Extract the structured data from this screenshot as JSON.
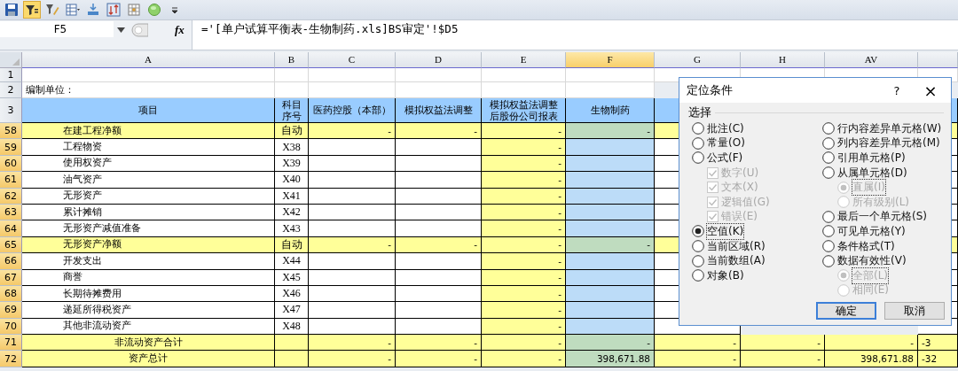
{
  "toolbar": [
    {
      "kind": "save",
      "selected": false
    },
    {
      "kind": "filter",
      "selected": true
    },
    {
      "kind": "clear-filter",
      "selected": false
    },
    {
      "kind": "table",
      "selected": false
    },
    {
      "kind": "insert",
      "selected": false
    },
    {
      "kind": "sort",
      "selected": false
    },
    {
      "kind": "grid",
      "selected": false
    },
    {
      "kind": "circle",
      "selected": false
    },
    {
      "kind": "more",
      "selected": false
    }
  ],
  "formula_bar": {
    "name_box": "F5",
    "fx": "fx",
    "formula": "='[单户试算平衡表-生物制药.xls]BS审定'!$D5"
  },
  "columns": [
    {
      "label": "A",
      "selected": false
    },
    {
      "label": "B",
      "selected": false
    },
    {
      "label": "C",
      "selected": false
    },
    {
      "label": "D",
      "selected": false
    },
    {
      "label": "E",
      "selected": false
    },
    {
      "label": "F",
      "selected": true
    },
    {
      "label": "G",
      "selected": false
    },
    {
      "label": "H",
      "selected": false
    },
    {
      "label": "AV",
      "selected": false
    }
  ],
  "rows": [
    {
      "num": "1",
      "kind": "blank",
      "selected": false
    },
    {
      "num": "2",
      "kind": "info",
      "selected": false,
      "item": "编制单位："
    },
    {
      "num": "3",
      "kind": "heading",
      "selected": false,
      "item": "项目",
      "code": "科目序号",
      "c": "医药控股（本部）",
      "d": "模拟权益法调整",
      "e": "模拟权益法调整后股份公司报表",
      "f": "生物制药"
    },
    {
      "num": "58",
      "kind": "subtotal",
      "selected": true,
      "item": "在建工程净额",
      "code": "自动",
      "c": "-",
      "d": "-",
      "e": "-",
      "f": "-"
    },
    {
      "num": "59",
      "kind": "detail",
      "selected": true,
      "item": "工程物资",
      "code": "X38",
      "e": "-"
    },
    {
      "num": "60",
      "kind": "detail",
      "selected": true,
      "item": "使用权资产",
      "code": "X39",
      "e": "-"
    },
    {
      "num": "61",
      "kind": "detail",
      "selected": true,
      "item": "油气资产",
      "code": "X40",
      "e": "-"
    },
    {
      "num": "62",
      "kind": "detail",
      "selected": true,
      "item": "无形资产",
      "code": "X41",
      "e": "-"
    },
    {
      "num": "63",
      "kind": "detail",
      "selected": true,
      "item": "累计摊销",
      "code": "X42",
      "e": "-"
    },
    {
      "num": "64",
      "kind": "detail",
      "selected": true,
      "item": "无形资产减值准备",
      "code": "X43",
      "e": "-"
    },
    {
      "num": "65",
      "kind": "subtotal",
      "selected": true,
      "item": "无形资产净额",
      "code": "自动",
      "c": "-",
      "d": "-",
      "e": "-",
      "f": "-"
    },
    {
      "num": "66",
      "kind": "detail",
      "selected": true,
      "item": "开发支出",
      "code": "X44",
      "e": "-"
    },
    {
      "num": "67",
      "kind": "detail",
      "selected": true,
      "item": "商誉",
      "code": "X45",
      "e": "-"
    },
    {
      "num": "68",
      "kind": "detail",
      "selected": true,
      "item": "长期待摊费用",
      "code": "X46",
      "e": "-"
    },
    {
      "num": "69",
      "kind": "detail",
      "selected": true,
      "item": "递延所得税资产",
      "code": "X47",
      "e": "-"
    },
    {
      "num": "70",
      "kind": "detail",
      "selected": true,
      "item": "其他非流动资产",
      "code": "X48",
      "e": "-"
    },
    {
      "num": "71",
      "kind": "total",
      "selected": true,
      "item": "非流动资产合计",
      "c": "-",
      "d": "-",
      "e": "-",
      "f": "-",
      "g": "-",
      "h": "-",
      "av": "-",
      "next": "-3"
    },
    {
      "num": "72",
      "kind": "total",
      "selected": true,
      "item": "资产总计",
      "c": "-",
      "d": "-",
      "e": "-",
      "f": "398,671.88",
      "g": "-",
      "h": "-",
      "av": "398,671.88",
      "next": "-32"
    }
  ],
  "dialog": {
    "title": "定位条件",
    "help": "?",
    "close": "×",
    "group": "选择",
    "left_options": [
      {
        "kind": "radio",
        "label": "批注(C)",
        "selected": false,
        "disabled": false
      },
      {
        "kind": "radio",
        "label": "常量(O)",
        "selected": false,
        "disabled": false
      },
      {
        "kind": "radio",
        "label": "公式(F)",
        "selected": false,
        "disabled": false,
        "children": [
          {
            "kind": "checkbox",
            "label": "数字(U)",
            "checked": true,
            "disabled": true
          },
          {
            "kind": "checkbox",
            "label": "文本(X)",
            "checked": true,
            "disabled": true
          },
          {
            "kind": "checkbox",
            "label": "逻辑值(G)",
            "checked": true,
            "disabled": true
          },
          {
            "kind": "checkbox",
            "label": "错误(E)",
            "checked": true,
            "disabled": true
          }
        ]
      },
      {
        "kind": "radio",
        "label": "空值(K)",
        "selected": true,
        "disabled": false
      },
      {
        "kind": "radio",
        "label": "当前区域(R)",
        "selected": false,
        "disabled": false
      },
      {
        "kind": "radio",
        "label": "当前数组(A)",
        "selected": false,
        "disabled": false
      },
      {
        "kind": "radio",
        "label": "对象(B)",
        "selected": false,
        "disabled": false
      }
    ],
    "right_options": [
      {
        "kind": "radio",
        "label": "行内容差异单元格(W)",
        "selected": false,
        "disabled": false
      },
      {
        "kind": "radio",
        "label": "列内容差异单元格(M)",
        "selected": false,
        "disabled": false
      },
      {
        "kind": "radio",
        "label": "引用单元格(P)",
        "selected": false,
        "disabled": false
      },
      {
        "kind": "radio",
        "label": "从属单元格(D)",
        "selected": false,
        "disabled": false,
        "children": [
          {
            "kind": "radio",
            "label": "直属(I)",
            "selected": true,
            "disabled": true
          },
          {
            "kind": "radio",
            "label": "所有级别(L)",
            "selected": false,
            "disabled": true
          }
        ]
      },
      {
        "kind": "radio",
        "label": "最后一个单元格(S)",
        "selected": false,
        "disabled": false
      },
      {
        "kind": "radio",
        "label": "可见单元格(Y)",
        "selected": false,
        "disabled": false
      },
      {
        "kind": "radio",
        "label": "条件格式(T)",
        "selected": false,
        "disabled": false
      },
      {
        "kind": "radio",
        "label": "数据有效性(V)",
        "selected": false,
        "disabled": false,
        "children": [
          {
            "kind": "radio",
            "label": "全部(L)",
            "selected": true,
            "disabled": true
          },
          {
            "kind": "radio",
            "label": "相同(E)",
            "selected": false,
            "disabled": true
          }
        ]
      }
    ],
    "buttons": [
      {
        "label": "确定",
        "default": true
      },
      {
        "label": "取消",
        "default": false
      }
    ]
  }
}
